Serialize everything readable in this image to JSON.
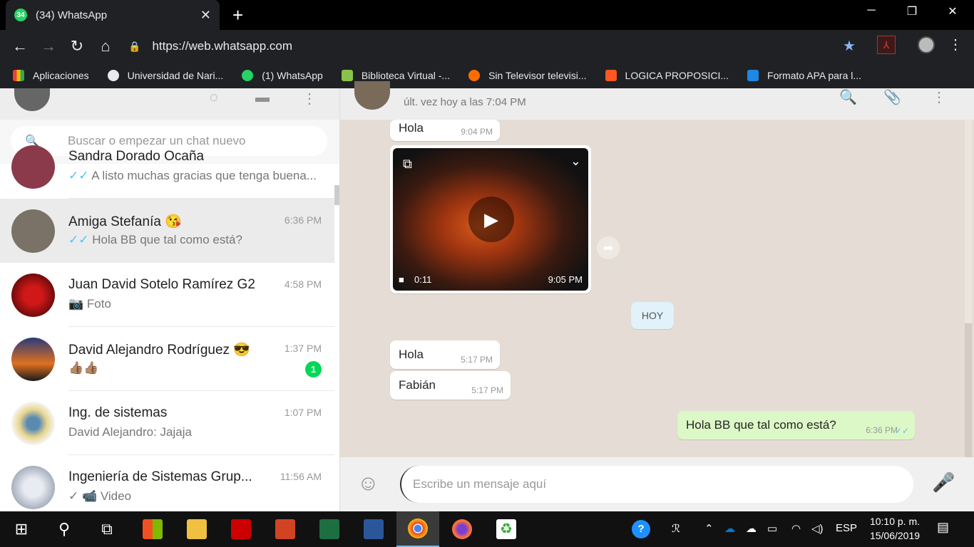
{
  "browser": {
    "tab_title": "(34) WhatsApp",
    "tab_badge": "34",
    "url": "https://web.whatsapp.com",
    "bookmarks": [
      {
        "label": "Aplicaciones",
        "color": "#e94235"
      },
      {
        "label": "Universidad de Nari...",
        "color": "#e8eaed"
      },
      {
        "label": "(1) WhatsApp",
        "color": "#25d366"
      },
      {
        "label": "Biblioteca Virtual -...",
        "color": "#8bc34a"
      },
      {
        "label": "Sin Televisor televisi...",
        "color": "#ff6d00"
      },
      {
        "label": "LOGICA PROPOSICI...",
        "color": "#ff5722"
      },
      {
        "label": "Formato APA para l...",
        "color": "#1e88e5"
      }
    ]
  },
  "left": {
    "search_placeholder": "Buscar o empezar un chat nuevo",
    "chats": [
      {
        "name": "Sandra Dorado Ocaña",
        "time": "",
        "ticks": "✓✓",
        "msg": "A listo muchas gracias que tenga buena...",
        "unread": "",
        "avatar_color": "#8a3a4a"
      },
      {
        "name": "Amiga Stefanía 😘",
        "time": "6:36 PM",
        "ticks": "✓✓",
        "msg": "Hola BB que tal como está?",
        "unread": "",
        "avatar_color": "#7a7266"
      },
      {
        "name": "Juan David Sotelo Ramírez G2",
        "time": "4:58 PM",
        "ticks": "",
        "msg": "📷 Foto",
        "unread": "",
        "avatar_color": "#9a1010"
      },
      {
        "name": "David Alejandro Rodríguez 😎",
        "time": "1:37 PM",
        "ticks": "",
        "msg": "👍🏽👍🏽",
        "unread": "1",
        "avatar_color": "#d46a20"
      },
      {
        "name": "Ing. de sistemas",
        "time": "1:07 PM",
        "ticks": "",
        "msg": "David Alejandro: Jajaja",
        "unread": "",
        "avatar_color": "#c9b77a"
      },
      {
        "name": "Ingeniería de Sistemas Grup...",
        "time": "11:56 AM",
        "ticks": "✓",
        "msg": "📹 Video",
        "unread": "",
        "avatar_color": "#b8bcc4"
      }
    ]
  },
  "right": {
    "contact_status": "últ. vez hoy a las 7:04 PM",
    "messages": {
      "m1_text": "Hola",
      "m1_time": "9:04 PM",
      "video_duration": "0:11",
      "video_time": "9:05 PM",
      "day_label": "HOY",
      "m2_text": "Hola",
      "m2_time": "5:17 PM",
      "m3_text": "Fabián",
      "m3_time": "5:17 PM",
      "m4_text": "Hola BB que tal como está?",
      "m4_time": "6:36 PM"
    },
    "input_placeholder": "Escribe un mensaje aquí"
  },
  "taskbar": {
    "lang": "ESP",
    "time": "10:10 p. m.",
    "date": "15/06/2019"
  }
}
